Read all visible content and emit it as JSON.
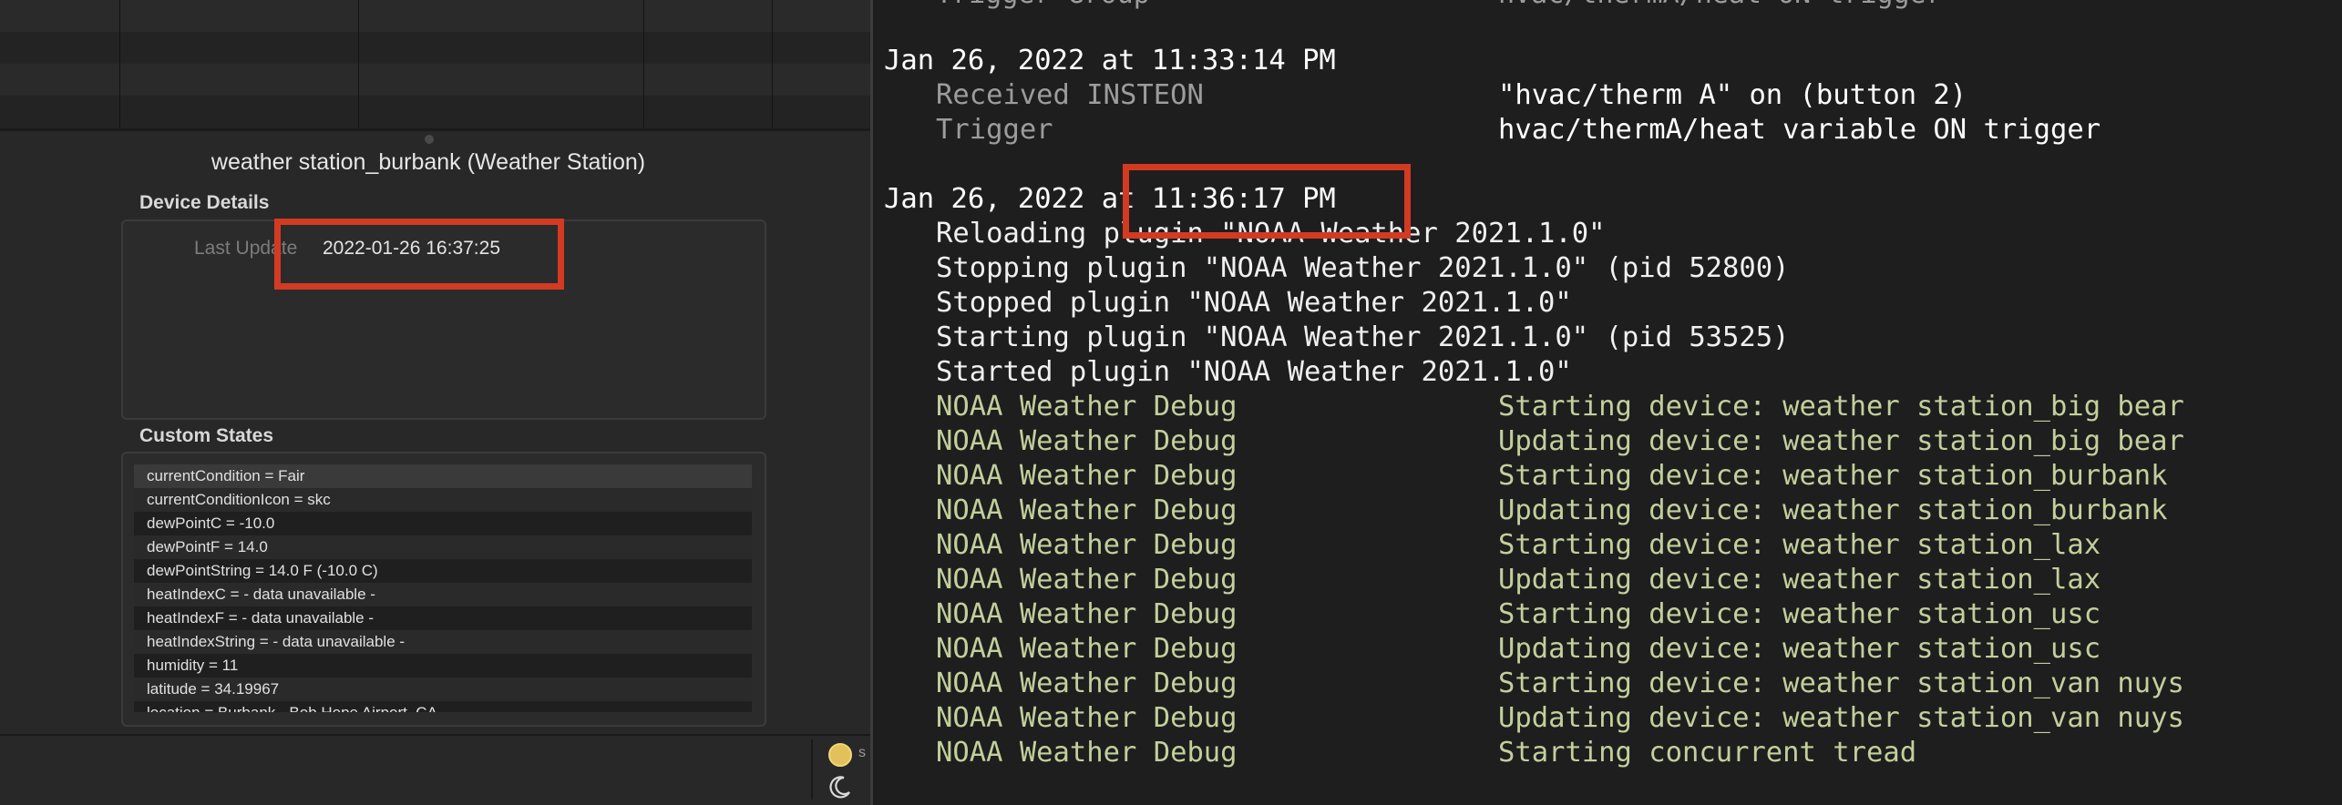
{
  "left_panel": {
    "device_title": "weather station_burbank (Weather Station)",
    "device_details": {
      "heading": "Device Details",
      "last_update_label": "Last Update",
      "last_update_value": "2022-01-26 16:37:25"
    },
    "custom_states": {
      "heading": "Custom States",
      "items": [
        "currentCondition = Fair",
        "currentConditionIcon = skc",
        "dewPointC = -10.0",
        "dewPointF = 14.0",
        "dewPointString = 14.0 F (-10.0 C)",
        "heatIndexC = - data unavailable -",
        "heatIndexF = - data unavailable -",
        "heatIndexString = - data unavailable -",
        "humidity = 11",
        "latitude = 34.19967",
        "location = Burbank - Bob Hope Airport, CA"
      ]
    },
    "status_bar": {
      "sun_icon": "sun-icon",
      "moon_icon": "moon-icon",
      "cut_text": "s"
    }
  },
  "log": {
    "top_cut_row": {
      "source": "Trigger Group",
      "message": "hvac/thermA/heat ON trigger"
    },
    "entries": [
      {
        "timestamp": "Jan 26, 2022 at 11:33:14 PM",
        "lines": [
          {
            "source": "Received INSTEON",
            "message": "\"hvac/therm A\" on (button 2)",
            "style": "system"
          },
          {
            "source": "Trigger",
            "message": "hvac/thermA/heat variable ON trigger",
            "style": "system"
          }
        ]
      },
      {
        "timestamp": "Jan 26, 2022 at 11:36:17 PM",
        "lines": [
          {
            "source": "Reloading plugin \"NOAA Weather 2021.1.0\"",
            "message": "",
            "style": "plain"
          },
          {
            "source": "Stopping plugin \"NOAA Weather 2021.1.0\" (pid 52800)",
            "message": "",
            "style": "plain"
          },
          {
            "source": "Stopped plugin \"NOAA Weather 2021.1.0\"",
            "message": "",
            "style": "plain"
          },
          {
            "source": "Starting plugin \"NOAA Weather 2021.1.0\" (pid 53525)",
            "message": "",
            "style": "plain"
          },
          {
            "source": "Started plugin \"NOAA Weather 2021.1.0\"",
            "message": "",
            "style": "plain"
          },
          {
            "source": "NOAA Weather Debug",
            "message": "Starting device: weather station_big bear",
            "style": "debug"
          },
          {
            "source": "NOAA Weather Debug",
            "message": "Updating device: weather station_big bear",
            "style": "debug"
          },
          {
            "source": "NOAA Weather Debug",
            "message": "Starting device: weather station_burbank",
            "style": "debug"
          },
          {
            "source": "NOAA Weather Debug",
            "message": "Updating device: weather station_burbank",
            "style": "debug"
          },
          {
            "source": "NOAA Weather Debug",
            "message": "Starting device: weather station_lax",
            "style": "debug"
          },
          {
            "source": "NOAA Weather Debug",
            "message": "Updating device: weather station_lax",
            "style": "debug"
          },
          {
            "source": "NOAA Weather Debug",
            "message": "Starting device: weather station_usc",
            "style": "debug"
          },
          {
            "source": "NOAA Weather Debug",
            "message": "Updating device: weather station_usc",
            "style": "debug"
          },
          {
            "source": "NOAA Weather Debug",
            "message": "Starting device: weather station_van nuys",
            "style": "debug"
          },
          {
            "source": "NOAA Weather Debug",
            "message": "Updating device: weather station_van nuys",
            "style": "debug"
          },
          {
            "source": "NOAA Weather Debug",
            "message": "Starting concurrent tread",
            "style": "debug"
          }
        ]
      }
    ]
  },
  "colors": {
    "annotation_red": "#d23b22",
    "log_debug_green": "#c3cf9c",
    "log_system_gray": "#9c9c9c",
    "background_dark": "#1e1e1e"
  }
}
